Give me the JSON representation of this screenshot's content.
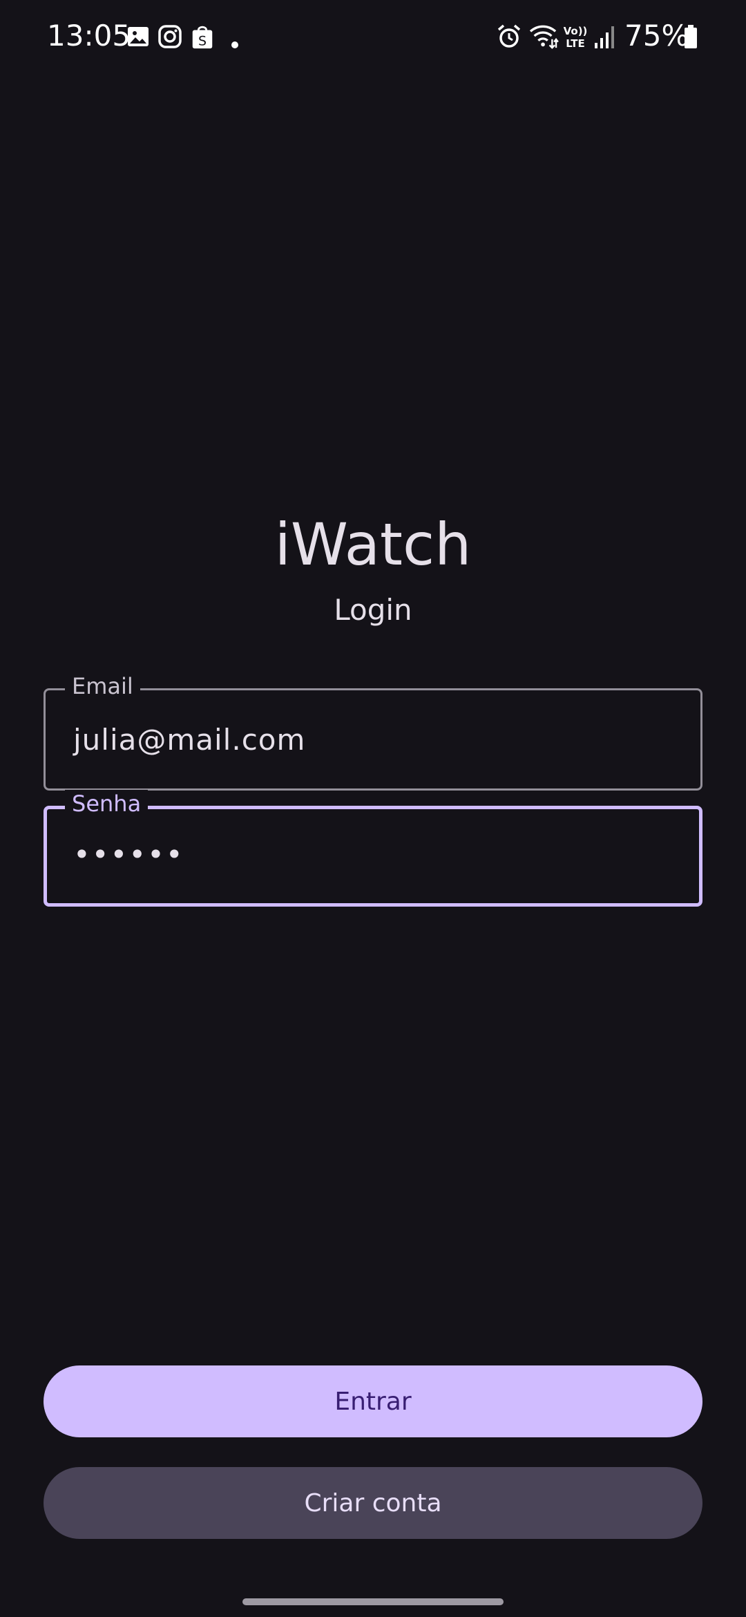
{
  "status_bar": {
    "time": "13:05",
    "notification_icons": [
      "gallery-icon",
      "instagram-icon",
      "shopping-bag-icon",
      "dot-icon"
    ],
    "system_icons": [
      "alarm-icon",
      "wifi-icon",
      "volte-icon",
      "signal-icon",
      "battery-icon"
    ],
    "volte_label": "Vo)) LTE",
    "battery_percent": "75%"
  },
  "header": {
    "app_title": "iWatch",
    "subtitle": "Login"
  },
  "form": {
    "email": {
      "label": "Email",
      "value": "julia@mail.com"
    },
    "password": {
      "label": "Senha",
      "value": "••••••",
      "focused": true
    }
  },
  "actions": {
    "login_label": "Entrar",
    "create_account_label": "Criar conta"
  },
  "colors": {
    "background": "#141218",
    "accent": "#d0bcff",
    "primary_button_text": "#381e72",
    "secondary_button_bg": "#4a4458",
    "outline": "#938f99"
  }
}
